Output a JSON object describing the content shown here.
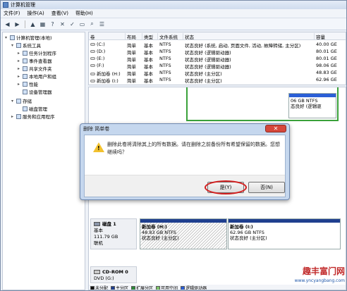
{
  "window": {
    "title": "计算机管理"
  },
  "menu": [
    "文件(F)",
    "操作(A)",
    "查看(V)",
    "帮助(H)"
  ],
  "toolbar_icons": [
    "back-icon",
    "forward-icon",
    "up-icon",
    "grid-icon",
    "help-icon",
    "close-icon",
    "check-icon",
    "folder-icon",
    "search-icon",
    "properties-icon"
  ],
  "tree": [
    {
      "label": "计算机管理(本地)",
      "level": 0,
      "expander": "▾"
    },
    {
      "label": "系统工具",
      "level": 1,
      "expander": "▾"
    },
    {
      "label": "任务计划程序",
      "level": 2,
      "expander": "▸"
    },
    {
      "label": "事件查看器",
      "level": 2,
      "expander": "▸"
    },
    {
      "label": "共享文件夹",
      "level": 2,
      "expander": "▸"
    },
    {
      "label": "本地用户和组",
      "level": 2,
      "expander": "▸"
    },
    {
      "label": "性能",
      "level": 2,
      "expander": "▸"
    },
    {
      "label": "设备管理器",
      "level": 2,
      "expander": ""
    },
    {
      "label": "存储",
      "level": 1,
      "expander": "▾"
    },
    {
      "label": "磁盘管理",
      "level": 2,
      "expander": ""
    },
    {
      "label": "服务和应用程序",
      "level": 1,
      "expander": "▸"
    }
  ],
  "volume_list": {
    "headers": [
      "卷",
      "布局",
      "类型",
      "文件系统",
      "状态",
      "容量"
    ],
    "rows": [
      [
        "(C:)",
        "简单",
        "基本",
        "NTFS",
        "状态良好 (系统, 启动, 页面文件, 活动, 故障转储, 主分区)",
        "40.00 GE"
      ],
      [
        "(D:)",
        "简单",
        "基本",
        "NTFS",
        "状态良好 (逻辑驱动器)",
        "80.01 GE"
      ],
      [
        "(E:)",
        "简单",
        "基本",
        "NTFS",
        "状态良好 (逻辑驱动器)",
        "80.01 GE"
      ],
      [
        "(F:)",
        "简单",
        "基本",
        "NTFS",
        "状态良好 (逻辑驱动器)",
        "98.06 GE"
      ],
      [
        "新加卷 (H:)",
        "简单",
        "基本",
        "NTFS",
        "状态良好 (主分区)",
        "48.83 GE"
      ],
      [
        "新加卷 (I:)",
        "简单",
        "基本",
        "NTFS",
        "状态良好 (主分区)",
        "62.96 GE"
      ]
    ]
  },
  "graph": {
    "disk0_part": {
      "size": "06 GB NTFS",
      "status": "态良好 (逻辑驱"
    },
    "disk1": {
      "name": "磁盘 1",
      "type": "基本",
      "size": "111.79 GB",
      "status": "联机"
    },
    "disk1_parts": [
      {
        "name": "新加卷 (H:)",
        "size": "48.83 GB NTFS",
        "status": "状态良好 (主分区)"
      },
      {
        "name": "新加卷 (I:)",
        "size": "62.96 GB NTFS",
        "status": "状态良好 (主分区)"
      }
    ],
    "cdrom": {
      "name": "CD-ROM 0",
      "type": "DVD (G:)"
    },
    "legend": [
      {
        "label": "未分配",
        "color": "#111111"
      },
      {
        "label": "主分区",
        "color": "#1f3f8f"
      },
      {
        "label": "扩展分区",
        "color": "#2e8b3a"
      },
      {
        "label": "可用空间",
        "color": "#7ec36a"
      },
      {
        "label": "逻辑驱动器",
        "color": "#2b5fd6"
      }
    ]
  },
  "dialog": {
    "title": "删除 简单卷",
    "message": "删除此卷将清除其上的所有数据。请在删除之前备份所有希望保留的数据。您想继续吗？",
    "yes_label": "是(Y)",
    "no_label": "否(N)"
  },
  "watermark": {
    "text": "趣丰富门网",
    "url": "www.yncyangbang.com"
  }
}
